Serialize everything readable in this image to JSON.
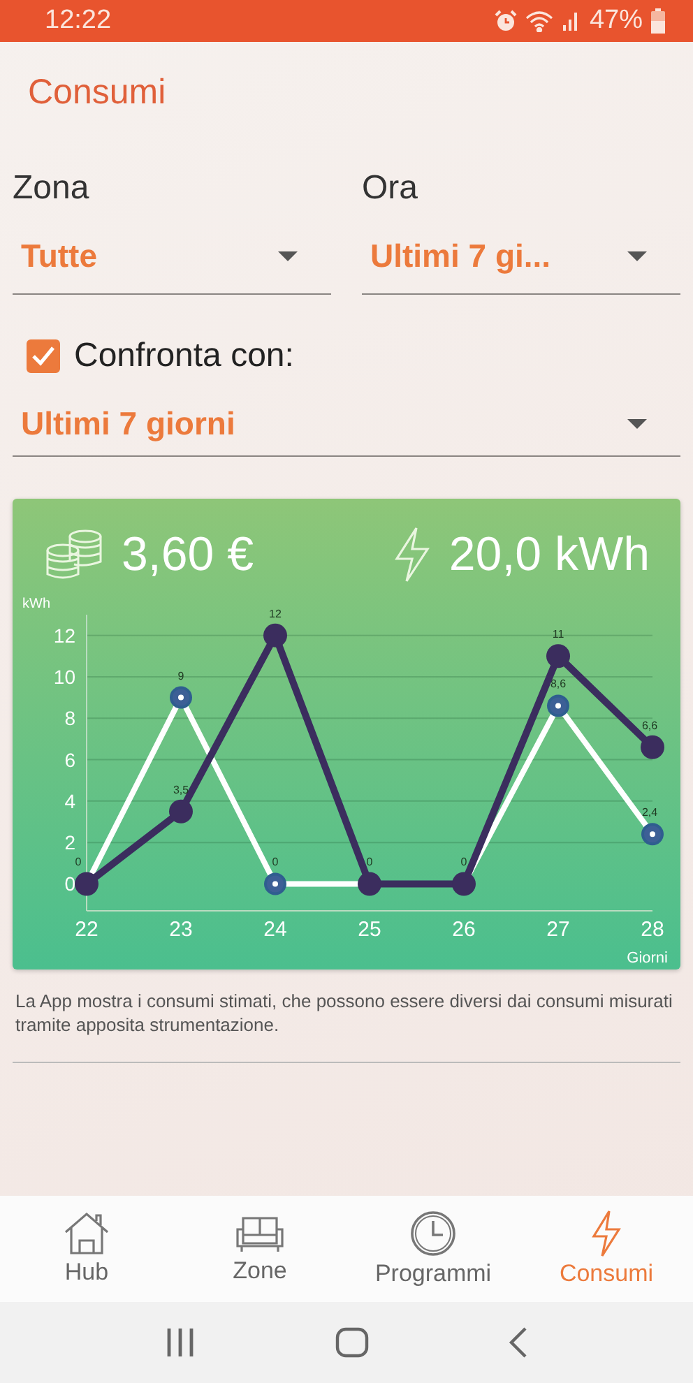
{
  "status_bar": {
    "time": "12:22",
    "battery": "47%"
  },
  "header": {
    "title": "Consumi"
  },
  "filters": [
    {
      "label": "Zona",
      "value": "Tutte"
    },
    {
      "label": "Ora",
      "value": "Ultimi 7 gi..."
    }
  ],
  "compare": {
    "checked": true,
    "label": "Confronta con:",
    "value": "Ultimi 7 giorni"
  },
  "summary": {
    "cost": "3,60 €",
    "energy": "20,0 kWh"
  },
  "chart_data": {
    "type": "line",
    "xlabel": "Giorni",
    "ylabel": "kWh",
    "categories": [
      "22",
      "23",
      "24",
      "25",
      "26",
      "27",
      "28"
    ],
    "series": [
      {
        "color": "#ffffff",
        "marker": "circle",
        "values": [
          0,
          9,
          0,
          0,
          0,
          8.6,
          2.4
        ],
        "value_labels": [
          "0",
          "9",
          "0",
          null,
          null,
          "8,6",
          "2,4"
        ]
      },
      {
        "color": "#3b2d5e",
        "marker": "circle",
        "values": [
          0,
          3.5,
          12,
          0,
          0,
          11,
          6.6
        ],
        "value_labels": [
          null,
          "3,5",
          "12",
          "0",
          "0",
          "11",
          "6,6"
        ]
      }
    ],
    "ylim": [
      -1.3,
      13
    ],
    "yticks": [
      0,
      2,
      4,
      6,
      8,
      10,
      12
    ],
    "grid": true,
    "data_labels": true
  },
  "note": "La App mostra i consumi stimati, che possono essere diversi dai consumi misurati tramite apposita strumentazione.",
  "nav": [
    {
      "label": "Hub",
      "kind": "home",
      "selected": false
    },
    {
      "label": "Zone",
      "kind": "sofa",
      "selected": false
    },
    {
      "label": "Programmi",
      "kind": "clock",
      "selected": false
    },
    {
      "label": "Consumi",
      "kind": "bolt",
      "selected": true
    }
  ]
}
